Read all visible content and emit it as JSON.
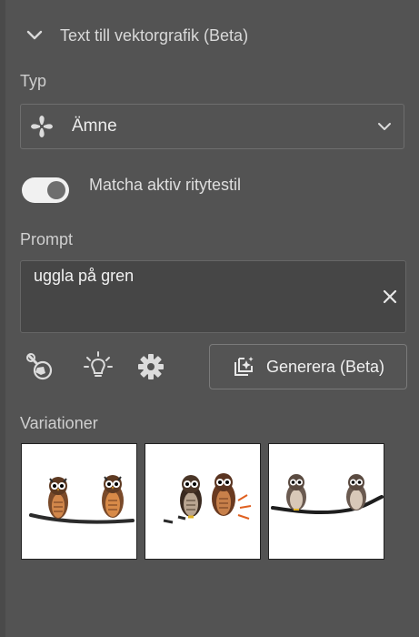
{
  "panel": {
    "header_title": "Text till vektorgrafik (Beta)"
  },
  "type_section": {
    "label": "Typ",
    "selected_value": "Ämne"
  },
  "style_toggle": {
    "label": "Matcha aktiv ritytestil",
    "checked": true
  },
  "prompt": {
    "label": "Prompt",
    "value": "uggla på gren"
  },
  "toolbar": {
    "icons": [
      "sample-style-icon",
      "lightbulb-icon",
      "gear-icon"
    ],
    "generate_label": "Generera (Beta)"
  },
  "variations": {
    "label": "Variationer",
    "count": 3
  },
  "colors": {
    "panel_bg": "#535353",
    "text": "#e6e6e6",
    "toggle_on": "#f1f1f1"
  }
}
